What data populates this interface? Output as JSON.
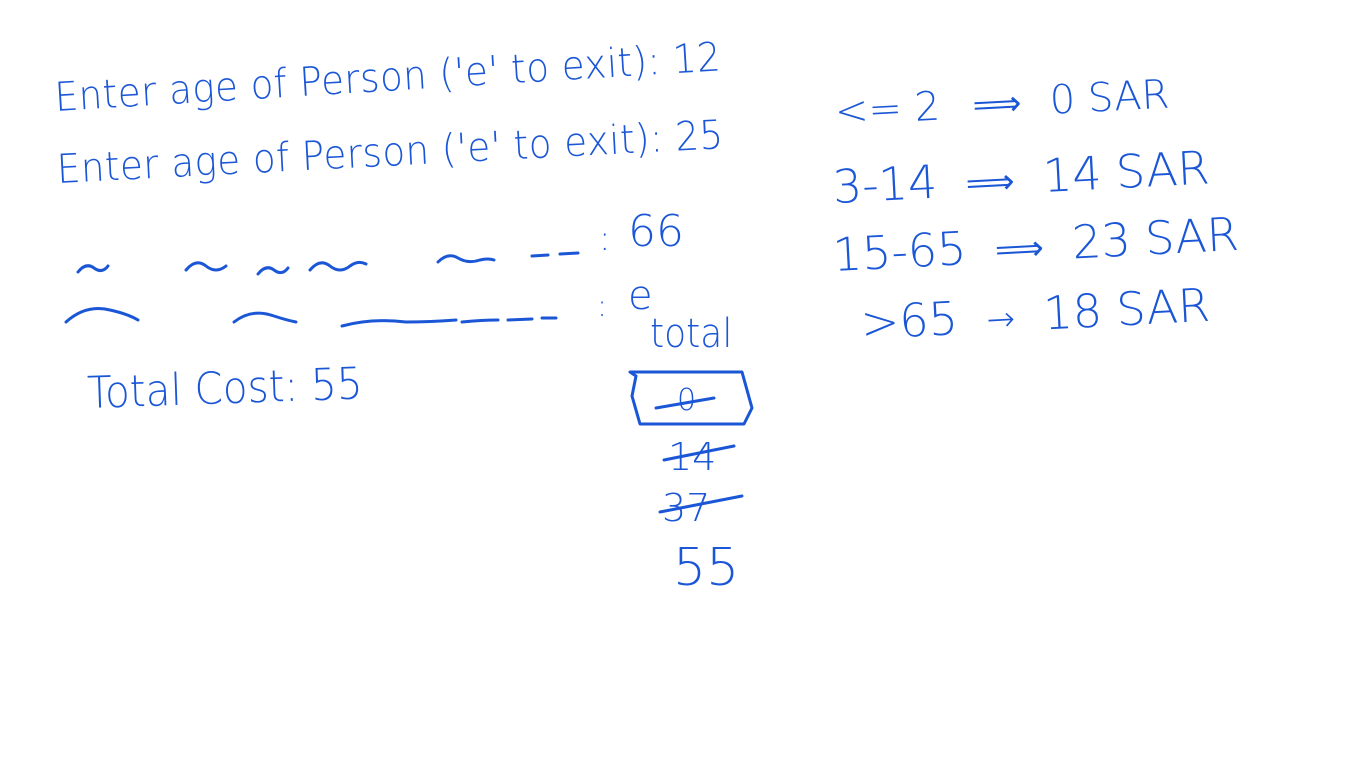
{
  "prompts": {
    "line1": "Enter age of Person ('e' to exit): 12",
    "line2": "Enter age of Person ('e' to exit): 25",
    "line3_value": "66",
    "line4_value": "e",
    "colon": ":"
  },
  "result": {
    "total_cost": "Total Cost: 55"
  },
  "trace": {
    "label": "total",
    "values": [
      "0",
      "14",
      "37",
      "55"
    ]
  },
  "pricing": [
    {
      "range": "<= 2",
      "arrow": "⟹",
      "price": "0 SAR"
    },
    {
      "range": "3-14",
      "arrow": "⟹",
      "price": "14 SAR"
    },
    {
      "range": "15-65",
      "arrow": "⟹",
      "price": "23 SAR"
    },
    {
      "range": ">65",
      "arrow": "→",
      "price": "18 SAR"
    }
  ],
  "colors": {
    "ink": "#1a56d6",
    "background": "#ffffff"
  }
}
